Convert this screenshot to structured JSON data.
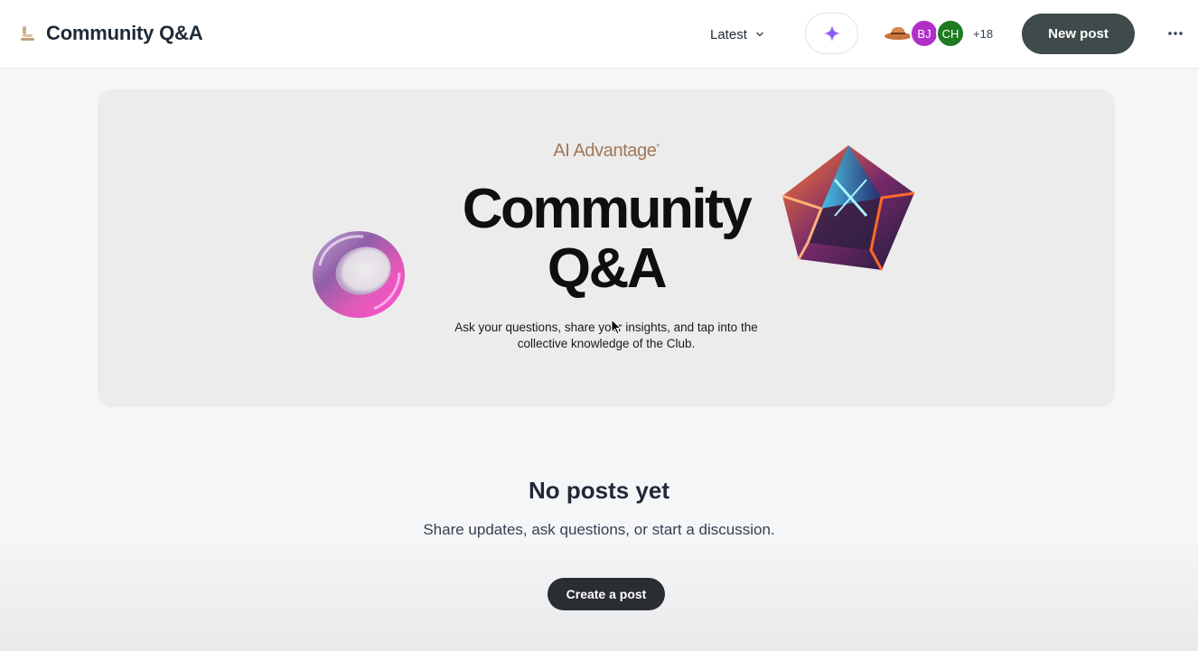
{
  "header": {
    "space_title": "Community Q&A",
    "sort_label": "Latest",
    "members": [
      {
        "initials": "BJ",
        "color": "#b02fc8"
      },
      {
        "initials": "CH",
        "color": "#1f7a22"
      }
    ],
    "more_members": "+18",
    "new_post_label": "New post"
  },
  "banner": {
    "brand": "AI Advantage",
    "brand_mark": "*",
    "title_line1": "Community",
    "title_line2": "Q&A",
    "subtitle": "Ask your questions, share your insights, and tap into the collective knowledge of the Club."
  },
  "empty_state": {
    "title": "No posts yet",
    "subtitle": "Share updates, ask questions, or start a discussion.",
    "cta_label": "Create a post"
  },
  "colors": {
    "primary_button": "#3f4a4a",
    "ai_accent": "#8b5cf6",
    "brand": "#a2775a"
  }
}
